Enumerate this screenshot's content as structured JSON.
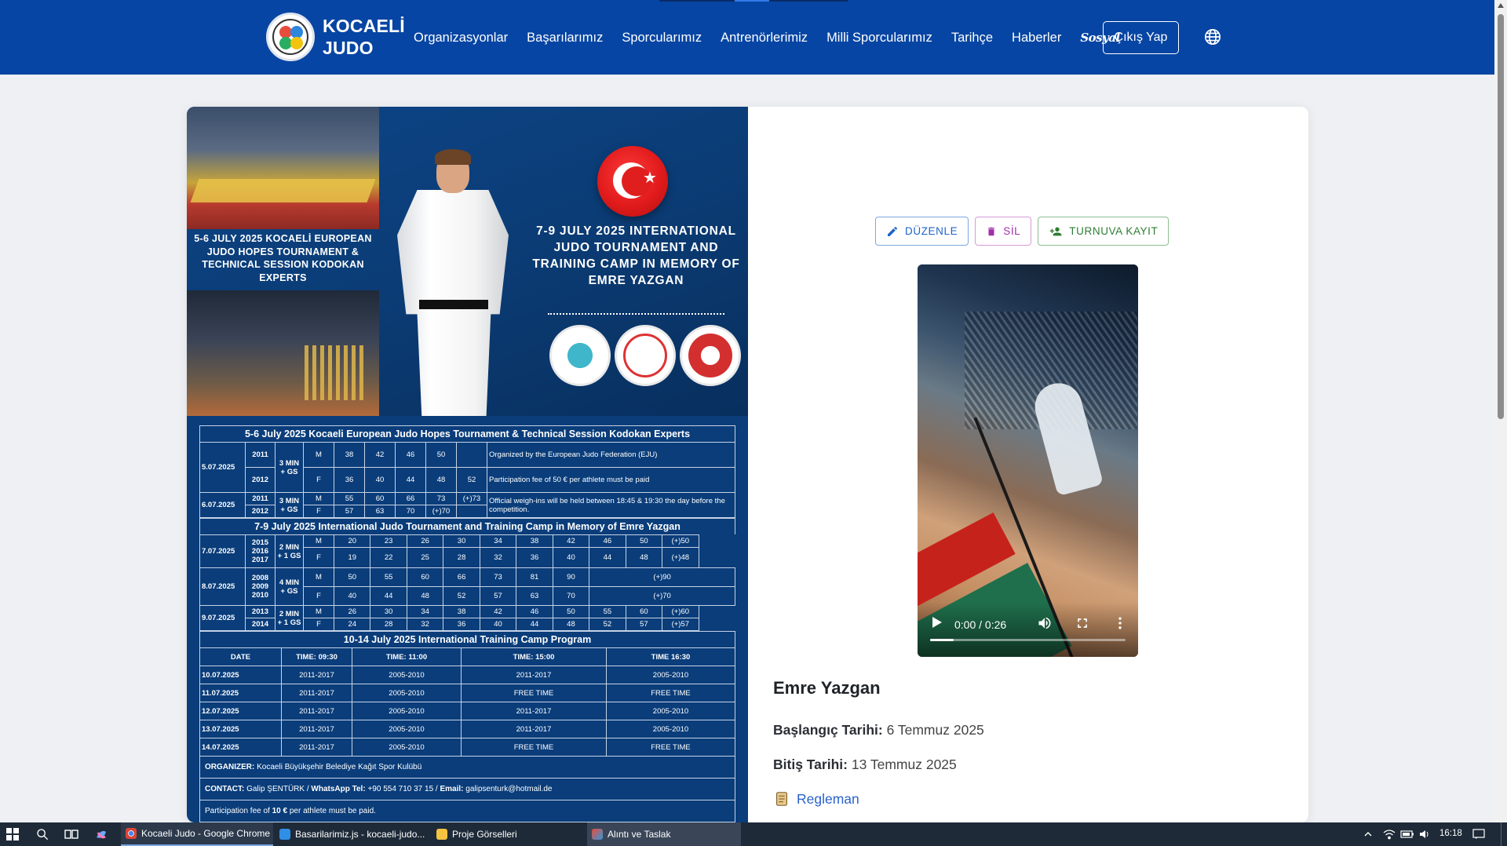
{
  "brand": {
    "line1": "KOCAELİ",
    "line2": "JUDO"
  },
  "nav": {
    "links": [
      "Organizasyonlar",
      "Başarılarımız",
      "Sporcularımız",
      "Antrenörlerimiz",
      "Milli Sporcularımız",
      "Tarihçe",
      "Haberler",
      "Sosyal"
    ],
    "logout": "Çıkış Yap",
    "globe_icon": "globe-icon"
  },
  "poster": {
    "left_text": "5-6 JULY 2025 KOCAELİ EUROPEAN JUDO HOPES TOURNAMENT & TECHNICAL SESSION KODOKAN EXPERTS",
    "right_title": "7-9 JULY 2025 INTERNATIONAL JUDO TOURNAMENT AND TRAINING CAMP IN MEMORY OF EMRE YAZGAN",
    "section1_title": "5-6 July 2025 Kocaeli European Judo Hopes Tournament & Technical Session Kodokan Experts",
    "section1_rows": [
      [
        "5.07.2025",
        "2011",
        "3 MIN + GS",
        "M",
        "38",
        "42",
        "46",
        "50",
        "",
        "Organized by the European Judo Federation (EJU)"
      ],
      [
        "",
        "2012",
        "",
        "F",
        "36",
        "40",
        "44",
        "48",
        "52",
        "Participation fee of 50 € per athlete must be paid"
      ],
      [
        "6.07.2025",
        "2011",
        "3 MIN + GS",
        "M",
        "55",
        "60",
        "66",
        "73",
        "(+)73",
        "Official weigh-ins will be held between 18:45 & 19:30 the day before the competition."
      ],
      [
        "",
        "2012",
        "",
        "F",
        "57",
        "63",
        "70",
        "(+)70",
        "",
        ""
      ]
    ],
    "section2_title": "7-9 July 2025 International Judo Tournament and Training Camp in Memory of Emre Yazgan",
    "section2_rows": [
      [
        "7.07.2025",
        "2015 2016 2017",
        "2 MIN + 1 GS",
        "M",
        "20",
        "23",
        "26",
        "30",
        "34",
        "38",
        "42",
        "46",
        "50",
        "(+)50"
      ],
      [
        "",
        "",
        "",
        "F",
        "19",
        "22",
        "25",
        "28",
        "32",
        "36",
        "40",
        "44",
        "48",
        "(+)48"
      ],
      [
        "8.07.2025",
        "2008 2009 2010",
        "4 MIN + GS",
        "M",
        "50",
        "55",
        "60",
        "66",
        "73",
        "81",
        "90",
        "(+)90",
        "",
        ""
      ],
      [
        "",
        "",
        "",
        "F",
        "40",
        "44",
        "48",
        "52",
        "57",
        "63",
        "70",
        "(+)70",
        "",
        ""
      ],
      [
        "9.07.2025",
        "2013",
        "2 MIN + 1 GS",
        "M",
        "26",
        "30",
        "34",
        "38",
        "42",
        "46",
        "50",
        "55",
        "60",
        "(+)60"
      ],
      [
        "",
        "2014",
        "",
        "F",
        "24",
        "28",
        "32",
        "36",
        "40",
        "44",
        "48",
        "52",
        "57",
        "(+)57"
      ]
    ],
    "section3_title": "10-14 July 2025 International Training Camp Program",
    "section3_header": [
      "DATE",
      "TIME: 09:30",
      "TIME: 11:00",
      "TIME: 15:00",
      "TIME 16:30"
    ],
    "section3_rows": [
      [
        "10.07.2025",
        "2011-2017",
        "2005-2010",
        "2011-2017",
        "2005-2010"
      ],
      [
        "11.07.2025",
        "2011-2017",
        "2005-2010",
        "FREE TIME",
        "FREE TIME"
      ],
      [
        "12.07.2025",
        "2011-2017",
        "2005-2010",
        "2011-2017",
        "2005-2010"
      ],
      [
        "13.07.2025",
        "2011-2017",
        "2005-2010",
        "2011-2017",
        "2005-2010"
      ],
      [
        "14.07.2025",
        "2011-2017",
        "2005-2010",
        "FREE TIME",
        "FREE TIME"
      ]
    ],
    "organizer_label": "ORGANIZER:",
    "organizer": "Kocaeli Büyükşehir Belediye Kağıt Spor Kulübü",
    "contact_label": "CONTACT:",
    "contact_name": "Galip ŞENTÜRK /",
    "whatsapp_label": "WhatsApp Tel:",
    "whatsapp": "+90 554 710 37 15 /",
    "email_label": "Email:",
    "email": "galipsenturk@hotmail.de",
    "fee_prefix": "Participation fee of",
    "fee_amount": "10 €",
    "fee_suffix": "per athlete must be paid."
  },
  "actions": {
    "edit": "DÜZENLE",
    "delete": "SİL",
    "register": "TURNUVA KAYIT"
  },
  "video": {
    "time": "0:00 / 0:26",
    "progress": 0.0
  },
  "event": {
    "title": "Emre Yazgan",
    "start_label": "Başlangıç Tarihi:",
    "start": "6 Temmuz 2025",
    "end_label": "Bitiş Tarihi:",
    "end": "13 Temmuz 2025",
    "reg_label": "Regleman"
  },
  "taskbar": {
    "apps": [
      "Kocaeli Judo - Google Chrome",
      "Basarilarimiz.js - kocaeli-judo...",
      "Proje Görselleri",
      "Alıntı ve Taslak"
    ],
    "clock": "16:18"
  },
  "colors": {
    "navbar": "#0645a3",
    "poster_bg": "#0a3d7a",
    "edit": "#1e63c9",
    "delete": "#a12ea9",
    "register": "#2e7d32",
    "link": "#2a62c9"
  }
}
